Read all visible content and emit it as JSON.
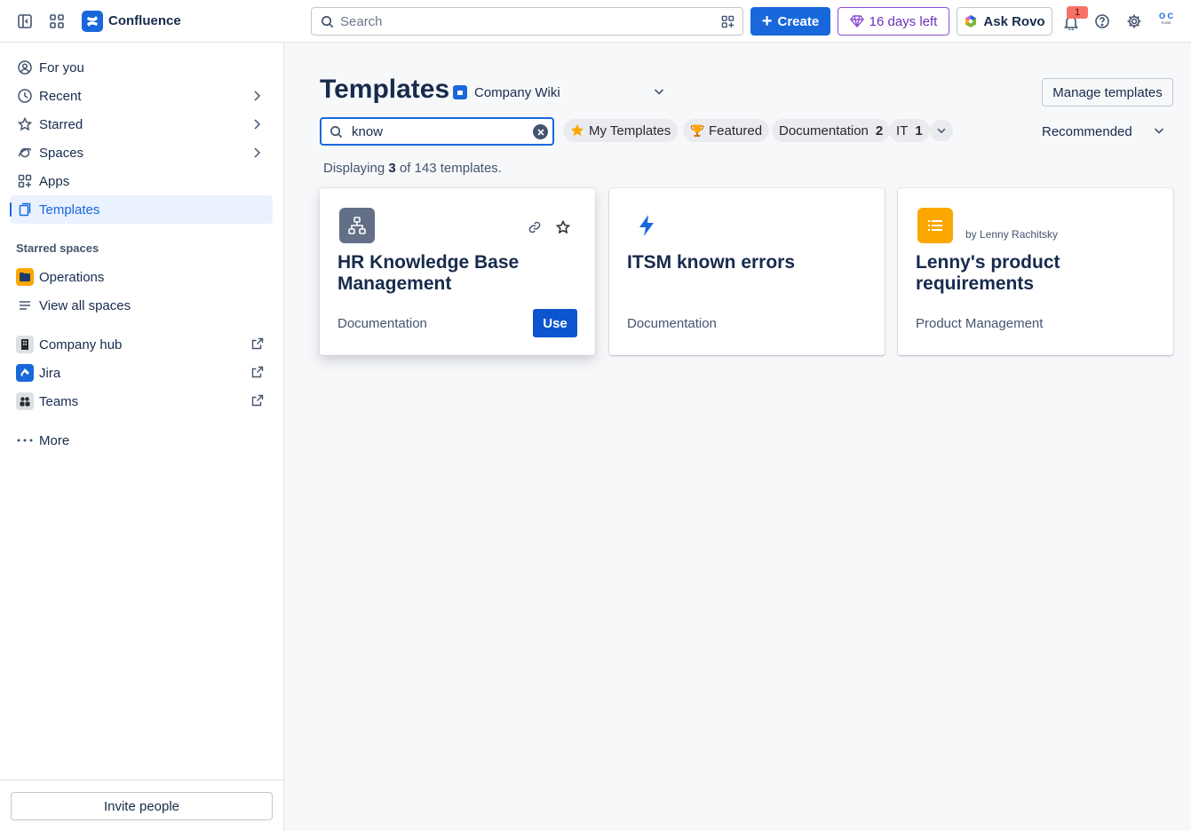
{
  "topbar": {
    "brand": "Confluence",
    "search_placeholder": "Search",
    "create_label": "Create",
    "trial_label": "16 days left",
    "rovo_label": "Ask Rovo",
    "notification_count": "1",
    "avatar_text_1": "O C",
    "avatar_text_2": "FUSE"
  },
  "sidebar": {
    "items": [
      {
        "label": "For you"
      },
      {
        "label": "Recent"
      },
      {
        "label": "Starred"
      },
      {
        "label": "Spaces"
      },
      {
        "label": "Apps"
      },
      {
        "label": "Templates"
      }
    ],
    "starred_spaces_label": "Starred spaces",
    "starred_spaces": [
      {
        "label": "Operations"
      },
      {
        "label": "View all spaces"
      }
    ],
    "links": [
      {
        "label": "Company hub"
      },
      {
        "label": "Jira"
      },
      {
        "label": "Teams"
      }
    ],
    "more_label": "More",
    "invite_label": "Invite people"
  },
  "main": {
    "title": "Templates",
    "space_name": "Company Wiki",
    "manage_label": "Manage templates",
    "search_value": "know",
    "filters": [
      {
        "label": "My Templates"
      },
      {
        "label": "Featured"
      },
      {
        "label": "Documentation",
        "count": "2"
      },
      {
        "label": "IT",
        "count": "1"
      }
    ],
    "sort_label": "Recommended",
    "displaying": {
      "prefix": "Displaying",
      "shown": "3",
      "middle": "of 143 templates."
    },
    "cards": [
      {
        "title": "HR Knowledge Base Management",
        "category": "Documentation",
        "use_label": "Use",
        "icon": "org-chart-icon",
        "icon_color": "#626f86"
      },
      {
        "title": "ITSM known errors",
        "category": "Documentation",
        "icon": "lightning-icon",
        "icon_color": "#1868db"
      },
      {
        "title": "Lenny's product requirements",
        "category": "Product Management",
        "author": "by Lenny Rachitsky",
        "icon": "list-icon",
        "icon_color": "#fca700"
      }
    ]
  },
  "colors": {
    "accent": "#1868db",
    "trial": "#8f4ed6",
    "featured_gold": "#fca700"
  }
}
